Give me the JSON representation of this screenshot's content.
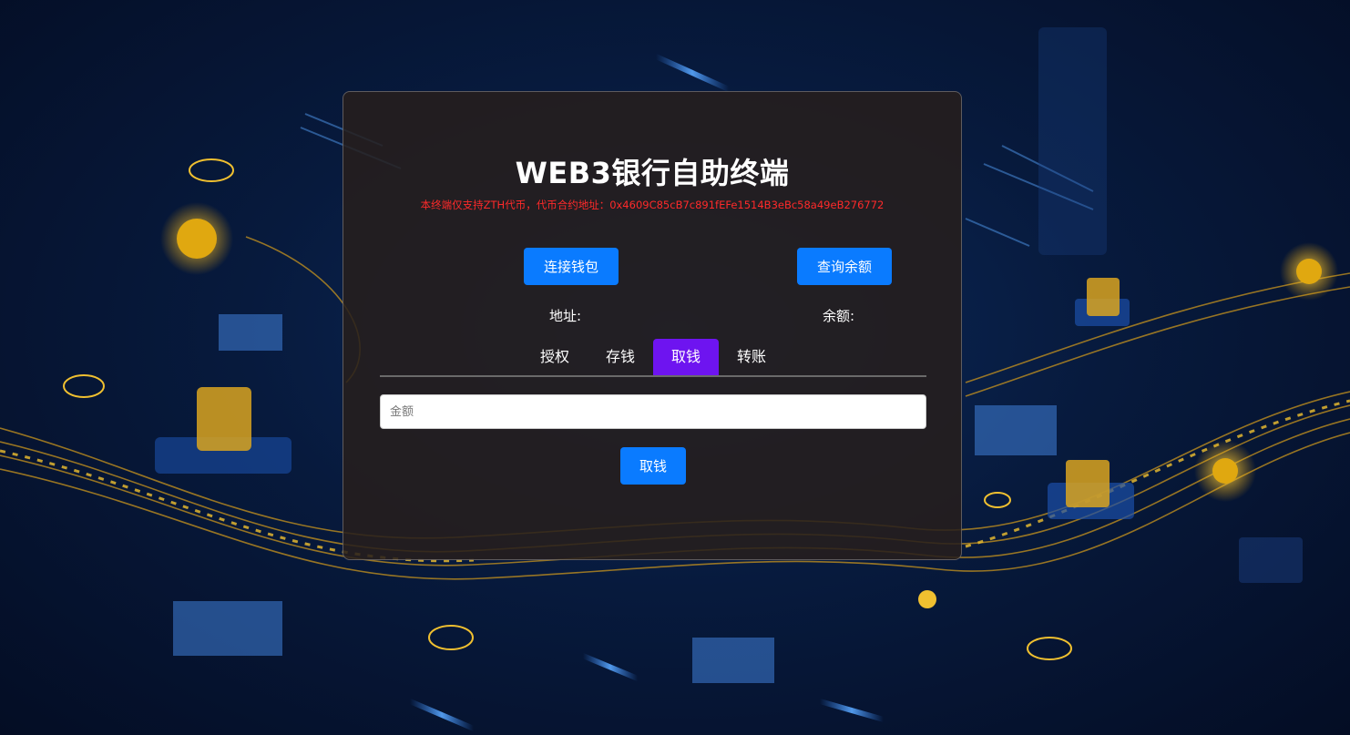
{
  "panel": {
    "title": "WEB3银行自助终端",
    "notice": "本终端仅支持ZTH代币，代币合约地址：0x4609C85cB7c891fEFe1514B3eBc58a49eB276772"
  },
  "actions": {
    "connect_wallet": "连接钱包",
    "query_balance": "查询余额"
  },
  "info": {
    "address_label": "地址:",
    "balance_label": "余额:"
  },
  "tabs": [
    {
      "label": "授权",
      "active": false
    },
    {
      "label": "存钱",
      "active": false
    },
    {
      "label": "取钱",
      "active": true
    },
    {
      "label": "转账",
      "active": false
    }
  ],
  "form": {
    "amount_placeholder": "金额",
    "amount_value": "",
    "submit_label": "取钱"
  },
  "colors": {
    "primary_button": "#0a7bff",
    "active_tab": "#6e14f0",
    "notice_text": "#ff2a2a",
    "panel_bg": "#261e1c"
  }
}
